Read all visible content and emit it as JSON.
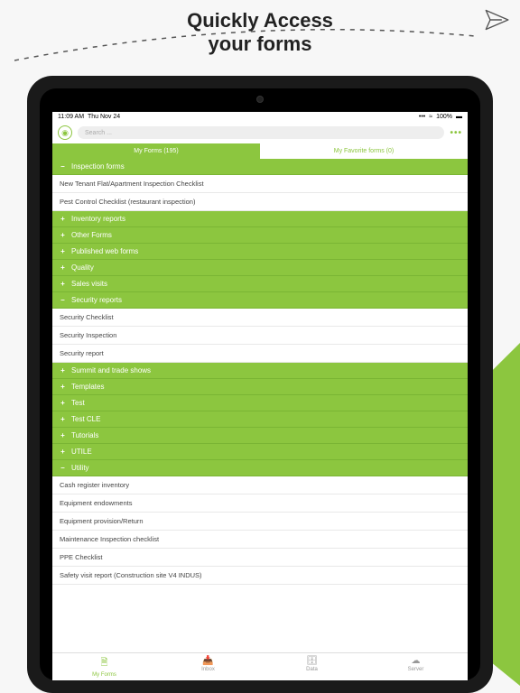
{
  "promo": {
    "line1": "Quickly Access",
    "line2": "your forms"
  },
  "status": {
    "time": "11:09 AM",
    "date": "Thu Nov 24",
    "signal": "•••",
    "wifi": "≈",
    "battery": "100%"
  },
  "search": {
    "placeholder": "Search ..."
  },
  "tabs": {
    "my": "My Forms (195)",
    "fav": "My Favorite forms (0)"
  },
  "rows": [
    {
      "t": "cat",
      "exp": false,
      "label": "Inspection forms"
    },
    {
      "t": "item",
      "label": "New Tenant Flat/Apartment Inspection Checklist"
    },
    {
      "t": "item",
      "label": "Pest Control Checklist (restaurant inspection)"
    },
    {
      "t": "cat",
      "exp": true,
      "label": "Inventory reports"
    },
    {
      "t": "cat",
      "exp": true,
      "label": "Other Forms"
    },
    {
      "t": "cat",
      "exp": true,
      "label": "Published web forms"
    },
    {
      "t": "cat",
      "exp": true,
      "label": "Quality"
    },
    {
      "t": "cat",
      "exp": true,
      "label": "Sales visits"
    },
    {
      "t": "cat",
      "exp": false,
      "label": "Security reports"
    },
    {
      "t": "item",
      "label": "Security Checklist"
    },
    {
      "t": "item",
      "label": "Security Inspection"
    },
    {
      "t": "item",
      "label": "Security report"
    },
    {
      "t": "cat",
      "exp": true,
      "label": "Summit and trade shows"
    },
    {
      "t": "cat",
      "exp": true,
      "label": "Templates"
    },
    {
      "t": "cat",
      "exp": true,
      "label": "Test"
    },
    {
      "t": "cat",
      "exp": true,
      "label": "Test CLE"
    },
    {
      "t": "cat",
      "exp": true,
      "label": "Tutorials"
    },
    {
      "t": "cat",
      "exp": true,
      "label": "UTILE"
    },
    {
      "t": "cat",
      "exp": false,
      "label": "Utility"
    },
    {
      "t": "item",
      "label": "Cash register inventory"
    },
    {
      "t": "item",
      "label": "Equipment endowments"
    },
    {
      "t": "item",
      "label": "Equipment provision/Return"
    },
    {
      "t": "item",
      "label": "Maintenance Inspection checklist"
    },
    {
      "t": "item",
      "label": "PPE Checklist"
    },
    {
      "t": "item",
      "label": "Safety visit report (Construction site V4 INDUS)"
    }
  ],
  "tabbar": {
    "myforms": "My Forms",
    "inbox": "Inbox",
    "data": "Data",
    "server": "Server"
  }
}
